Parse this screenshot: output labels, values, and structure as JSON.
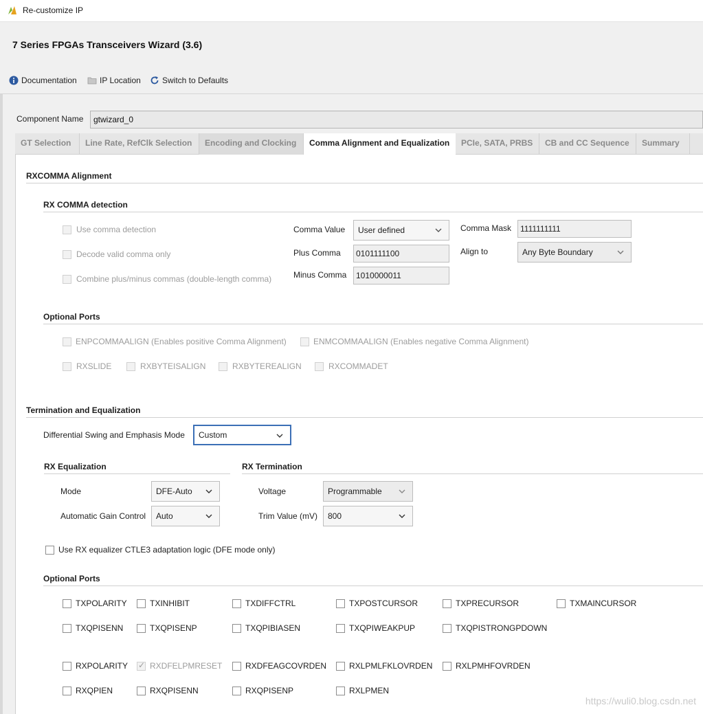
{
  "window": {
    "title": "Re-customize IP"
  },
  "header": {
    "title": "7 Series FPGAs Transceivers Wizard (3.6)"
  },
  "toolbar": {
    "documentation": "Documentation",
    "ip_location": "IP Location",
    "switch_defaults": "Switch to Defaults"
  },
  "component": {
    "label": "Component Name",
    "value": "gtwizard_0"
  },
  "tabs": [
    {
      "label": "GT Selection"
    },
    {
      "label": "Line Rate, RefClk Selection"
    },
    {
      "label": "Encoding and Clocking"
    },
    {
      "label": "Comma Alignment and Equalization"
    },
    {
      "label": "PCIe, SATA, PRBS"
    },
    {
      "label": "CB and CC Sequence"
    },
    {
      "label": "Summary"
    }
  ],
  "rxcomma": {
    "section_title": "RXCOMMA Alignment",
    "detection_title": "RX COMMA detection",
    "use_comma": "Use comma detection",
    "decode_valid": "Decode valid comma only",
    "combine": "Combine plus/minus commas (double-length comma)",
    "comma_value_label": "Comma Value",
    "comma_value": "User defined",
    "plus_comma_label": "Plus Comma",
    "plus_comma": "0101111100",
    "minus_comma_label": "Minus Comma",
    "minus_comma": "1010000011",
    "comma_mask_label": "Comma Mask",
    "comma_mask": "1111111111",
    "align_to_label": "Align to",
    "align_to": "Any Byte Boundary",
    "optional_ports_title": "Optional Ports",
    "enpcommaalign": "ENPCOMMAALIGN (Enables positive Comma Alignment)",
    "enmcommaalign": "ENMCOMMAALIGN (Enables negative Comma Alignment)",
    "rxslide": "RXSLIDE",
    "rxbyteisalign": "RXBYTEISALIGN",
    "rxbyterealign": "RXBYTEREALIGN",
    "rxcommadet": "RXCOMMADET"
  },
  "termination": {
    "section_title": "Termination and Equalization",
    "swing_label": "Differential Swing and Emphasis Mode",
    "swing_value": "Custom",
    "rx_eq_title": "RX Equalization",
    "mode_label": "Mode",
    "mode_value": "DFE-Auto",
    "agc_label": "Automatic Gain Control",
    "agc_value": "Auto",
    "rx_term_title": "RX Termination",
    "voltage_label": "Voltage",
    "voltage_value": "Programmable",
    "trim_label": "Trim Value (mV)",
    "trim_value": "800",
    "ctle3_label": "Use RX equalizer CTLE3 adaptation logic (DFE mode only)",
    "optional_ports_title": "Optional Ports",
    "ports_row1": [
      "TXPOLARITY",
      "TXINHIBIT",
      "TXDIFFCTRL",
      "TXPOSTCURSOR",
      "TXPRECURSOR",
      "TXMAINCURSOR"
    ],
    "ports_row2": [
      "TXQPISENN",
      "TXQPISENP",
      "TXQPIBIASEN",
      "TXQPIWEAKPUP",
      "TXQPISTRONGPDOWN"
    ],
    "ports_row3": [
      "RXPOLARITY",
      "RXDFELPMRESET",
      "RXDFEAGCOVRDEN",
      "RXLPMLFKLOVRDEN",
      "RXLPMHFOVRDEN"
    ],
    "ports_row4": [
      "RXQPIEN",
      "RXQPISENN",
      "RXQPISENP",
      "RXLPMEN"
    ]
  },
  "watermark": "https://wuli0.blog.csdn.net"
}
